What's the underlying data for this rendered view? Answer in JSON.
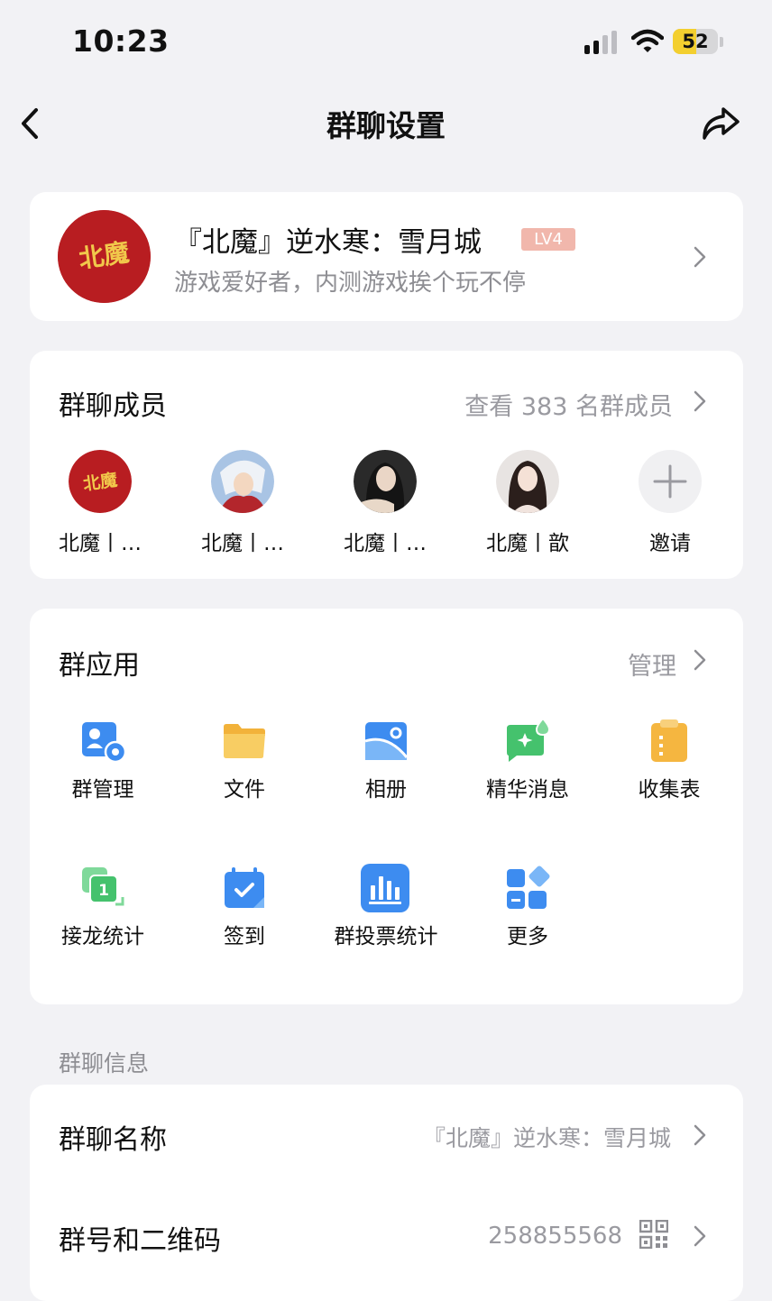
{
  "status_bar": {
    "time": "10:23",
    "battery": "52",
    "battery_level": 0.52
  },
  "nav": {
    "title": "群聊设置"
  },
  "group": {
    "avatar_text": "北魔",
    "name": "『北魔』逆水寒：雪月城",
    "level": "LV4",
    "description": "游戏爱好者，内测游戏挨个玩不停"
  },
  "members": {
    "title": "群聊成员",
    "view_all": "查看 383 名群成员",
    "list": [
      {
        "name": "北魔丨…",
        "avatar": "bei-mo-logo"
      },
      {
        "name": "北魔丨…",
        "avatar": "anime-character"
      },
      {
        "name": "北魔丨…",
        "avatar": "portrait-dark"
      },
      {
        "name": "北魔丨歆",
        "avatar": "portrait-light"
      }
    ],
    "invite_label": "邀请"
  },
  "apps": {
    "title": "群应用",
    "manage": "管理",
    "items": [
      {
        "label": "群管理",
        "icon": "group-manage-icon"
      },
      {
        "label": "文件",
        "icon": "folder-icon"
      },
      {
        "label": "相册",
        "icon": "album-icon"
      },
      {
        "label": "精华消息",
        "icon": "essence-message-icon"
      },
      {
        "label": "收集表",
        "icon": "collection-form-icon"
      },
      {
        "label": "接龙统计",
        "icon": "relay-stats-icon"
      },
      {
        "label": "签到",
        "icon": "check-in-icon"
      },
      {
        "label": "群投票统计",
        "icon": "vote-stats-icon"
      },
      {
        "label": "更多",
        "icon": "more-apps-icon"
      }
    ]
  },
  "info": {
    "section_label": "群聊信息",
    "rows": [
      {
        "title": "群聊名称",
        "value": "『北魔』逆水寒：雪月城"
      },
      {
        "title": "群号和二维码",
        "value": "258855568"
      }
    ]
  },
  "colors": {
    "background": "#f2f2f5",
    "brand_red": "#b81d21",
    "gold": "#f3cf2f",
    "app_blue": "#3d8cf0",
    "app_green": "#45c26d",
    "app_orange": "#f5b640"
  }
}
